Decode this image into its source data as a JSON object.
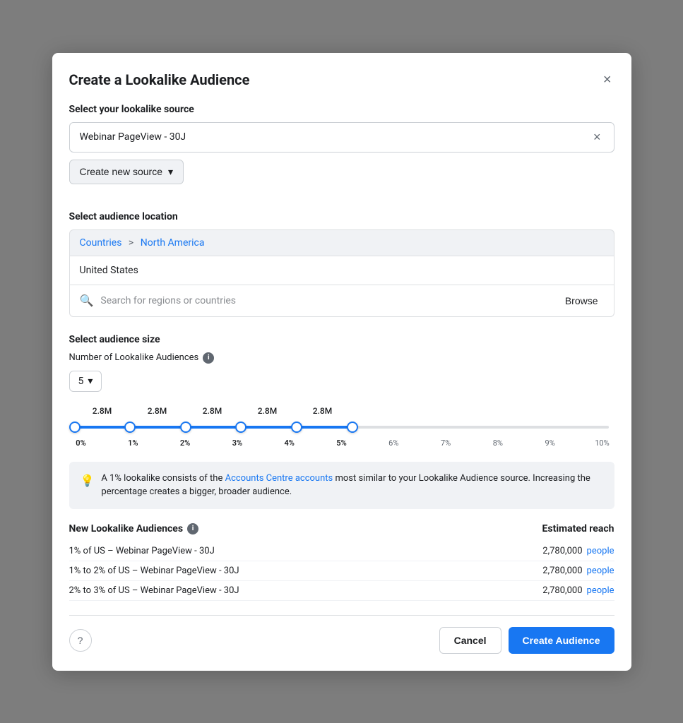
{
  "modal": {
    "title": "Create a Lookalike Audience",
    "close_label": "×"
  },
  "source_section": {
    "label": "Select your lookalike source",
    "selected_value": "Webinar PageView - 30J",
    "clear_label": "×",
    "create_source_label": "Create new source",
    "create_source_icon": "▾"
  },
  "location_section": {
    "label": "Select audience location",
    "breadcrumb_countries": "Countries",
    "breadcrumb_region": "North America",
    "selected_country": "United States",
    "search_placeholder": "Search for regions or countries",
    "browse_label": "Browse"
  },
  "audience_size_section": {
    "label": "Select audience size",
    "sub_label": "Number of Lookalike Audiences",
    "number_value": "5",
    "number_icon": "▾",
    "slider_values": [
      "2.8M",
      "2.8M",
      "2.8M",
      "2.8M",
      "2.8M"
    ],
    "slider_pct_labels": [
      "0%",
      "1%",
      "2%",
      "3%",
      "4%",
      "5%",
      "6%",
      "7%",
      "8%",
      "9%",
      "10%"
    ],
    "active_pct_count": 6
  },
  "tip": {
    "icon": "💡",
    "text_before": "A 1% lookalike consists of the ",
    "link_text": "Accounts Centre accounts",
    "text_after": " most similar to your Lookalike Audience source. Increasing the percentage creates a bigger, broader audience."
  },
  "audiences_table": {
    "col1_label": "New Lookalike Audiences",
    "col2_label": "Estimated reach",
    "rows": [
      {
        "name": "1% of US – Webinar PageView - 30J",
        "reach": "2,780,000",
        "reach_link": "people"
      },
      {
        "name": "1% to 2% of US – Webinar PageView - 30J",
        "reach": "2,780,000",
        "reach_link": "people"
      },
      {
        "name": "2% to 3% of US – Webinar PageView - 30J",
        "reach": "2,780,000",
        "reach_link": "people"
      }
    ]
  },
  "footer": {
    "help_icon": "?",
    "cancel_label": "Cancel",
    "create_label": "Create Audience"
  }
}
